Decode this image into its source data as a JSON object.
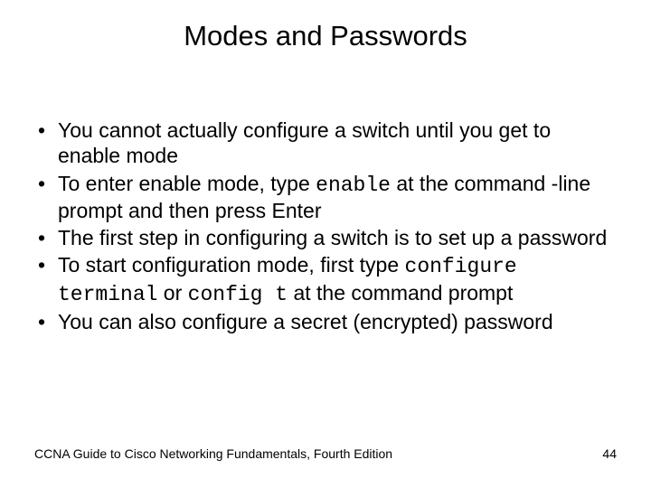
{
  "title": "Modes and Passwords",
  "bullets": [
    {
      "pre": "You cannot actually configure a switch until you get to enable mode",
      "code": "",
      "post": ""
    },
    {
      "pre": "To enter enable mode, type ",
      "code": "enable",
      "post": " at the command -line prompt and then press Enter"
    },
    {
      "pre": "The first step in configuring a switch is to set up a password",
      "code": "",
      "post": ""
    },
    {
      "pre": "To start configuration mode, first type ",
      "code": "configure terminal",
      "post": " or ",
      "code2": "config t",
      "post2": " at the command prompt"
    },
    {
      "pre": "You can also configure a secret (encrypted) password",
      "code": "",
      "post": ""
    }
  ],
  "footer": {
    "source": "CCNA Guide to Cisco Networking Fundamentals, Fourth Edition",
    "page": "44"
  }
}
